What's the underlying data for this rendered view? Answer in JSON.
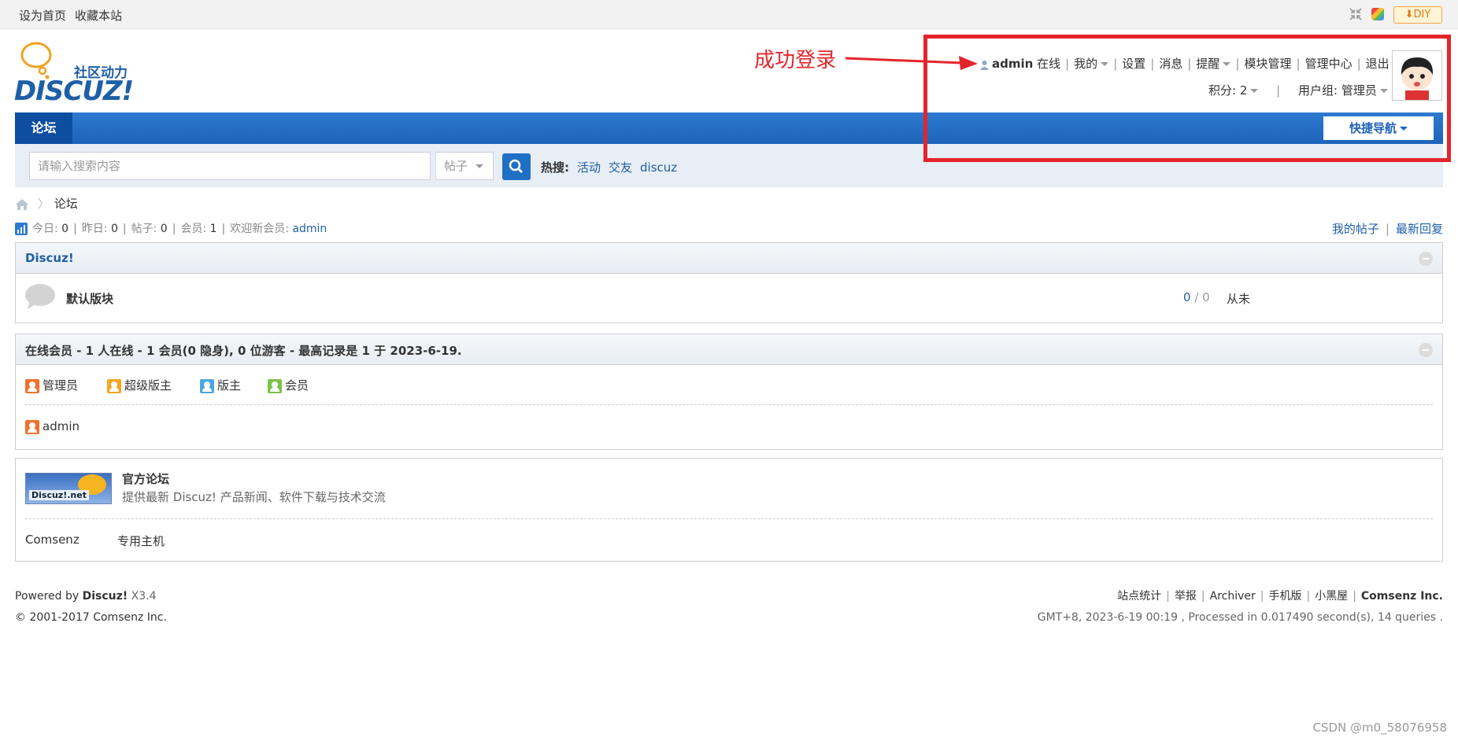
{
  "topbar": {
    "set_home": "设为首页",
    "bookmark": "收藏本站",
    "diy_label": "DIY"
  },
  "logo": {
    "tagline": "社区动力",
    "wordmark": "DISCUZ!"
  },
  "usermenu": {
    "username": "admin",
    "status": "在线",
    "mine": "我的",
    "settings": "设置",
    "messages": "消息",
    "reminders": "提醒",
    "module_manage": "模块管理",
    "admin_center": "管理中心",
    "logout": "退出",
    "credits": "积分: 2",
    "usergroup": "用户组: 管理员"
  },
  "nav": {
    "forum_tab": "论坛",
    "quick_nav": "快捷导航"
  },
  "search": {
    "placeholder": "请输入搜索内容",
    "type": "帖子",
    "hot_label": "热搜:",
    "hot_items": [
      "活动",
      "交友",
      "discuz"
    ]
  },
  "breadcrumb": {
    "current": "论坛"
  },
  "stats": {
    "today_label": "今日:",
    "today": "0",
    "yesterday_label": "昨日:",
    "yesterday": "0",
    "posts_label": "帖子:",
    "posts": "0",
    "members_label": "会员:",
    "members": "1",
    "welcome_label": "欢迎新会员:",
    "newest": "admin",
    "my_posts": "我的帖子",
    "latest_replies": "最新回复"
  },
  "category": {
    "title": "Discuz!",
    "forums": [
      {
        "name": "默认版块",
        "threads": "0",
        "posts": "0",
        "last": "从未"
      }
    ]
  },
  "online": {
    "title": "在线会员 - 1 人在线 - 1 会员(0 隐身), 0 位游客 - 最高记录是 1 于 2023-6-19.",
    "legend": [
      {
        "label": "管理员",
        "color": "#f0712b"
      },
      {
        "label": "超级版主",
        "color": "#f5a623"
      },
      {
        "label": "版主",
        "color": "#4aa8e0"
      },
      {
        "label": "会员",
        "color": "#7cc24a"
      }
    ],
    "users": [
      {
        "name": "admin",
        "color": "#f0712b"
      }
    ]
  },
  "links": {
    "banner_text": "Discuz!.net",
    "official_title": "官方论坛",
    "official_desc": "提供最新 Discuz! 产品新闻、软件下载与技术交流",
    "text_links": [
      "Comsenz",
      "专用主机"
    ]
  },
  "footer": {
    "powered_prefix": "Powered by",
    "powered_name": "Discuz!",
    "version": "X3.4",
    "copyright": "© 2001-2017 Comsenz Inc.",
    "links": [
      "站点统计",
      "举报",
      "Archiver",
      "手机版",
      "小黑屋"
    ],
    "company": "Comsenz Inc.",
    "process_info": "GMT+8, 2023-6-19 00:19 , Processed in 0.017490 second(s), 14 queries ."
  },
  "annotation": {
    "text": "成功登录"
  },
  "watermark": "CSDN @m0_58076958"
}
